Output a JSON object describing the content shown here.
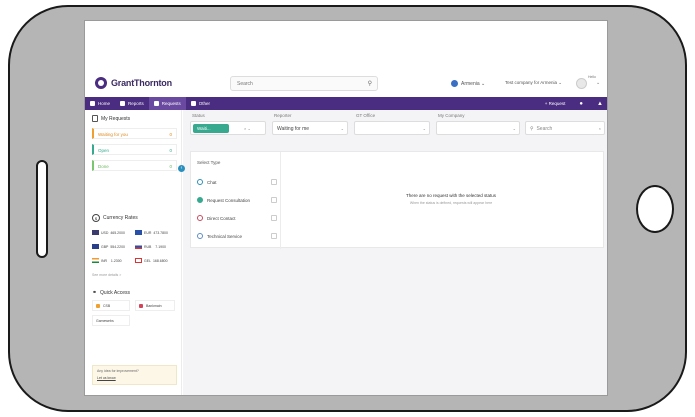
{
  "app": {
    "logo_text": "GrantThornton",
    "search_placeholder": "Search",
    "language": "Armenia",
    "company": "Test company for Armenia",
    "user_label": "Hello"
  },
  "nav": {
    "items": [
      {
        "label": "Home"
      },
      {
        "label": "Reports"
      },
      {
        "label": "Requests",
        "active": true
      },
      {
        "label": "Other"
      }
    ],
    "request_button": "+ Request"
  },
  "sidebar": {
    "title": "My Requests",
    "statuses": [
      {
        "label": "Waiting for you",
        "count": "0",
        "color": "#f0a030"
      },
      {
        "label": "Open",
        "count": "0",
        "color": "#37a98f"
      },
      {
        "label": "Done",
        "count": "0",
        "color": "#7ac76f"
      }
    ],
    "currency_title": "Currency Rates",
    "rates": [
      {
        "code": "USD",
        "value": "465.2000"
      },
      {
        "code": "EUR",
        "value": "473.7800"
      },
      {
        "code": "GBP",
        "value": "554.2200"
      },
      {
        "code": "RUB",
        "value": "7.1900"
      },
      {
        "code": "INR",
        "value": "1.2300"
      },
      {
        "code": "GEL",
        "value": "168.6800"
      }
    ],
    "see_more": "See more details >",
    "quick_access_title": "Quick Access",
    "quick_access": [
      "CSB",
      "Bankmain",
      "Gamewebs"
    ],
    "idea_text": "Any idea for improvement?",
    "idea_link": "Let us know"
  },
  "filters": {
    "status_label": "Status",
    "status_chip": "Waiti...",
    "reporter_label": "Reporter",
    "reporter_value": "Waiting for me",
    "gt_office_label": "GT Office",
    "company_label": "My Company",
    "search_placeholder": "Search"
  },
  "panel": {
    "select_type": "Select Type",
    "types": [
      {
        "label": "Chat",
        "color": "#2a8fbd"
      },
      {
        "label": "Request Consultation",
        "color": "#37a98f"
      },
      {
        "label": "Direct Contact",
        "color": "#d0455a"
      },
      {
        "label": "Technical Service",
        "color": "#5a8cd0"
      }
    ],
    "empty_title": "There are no request with the selected status",
    "empty_sub": "When the status is defined, requests will appear here"
  }
}
